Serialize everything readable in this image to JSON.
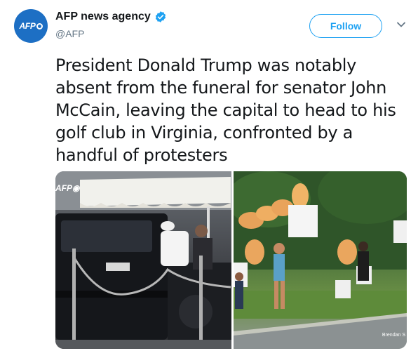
{
  "account": {
    "display_name": "AFP news agency",
    "handle": "@AFP",
    "avatar_text": "AFP",
    "verified": true
  },
  "follow_button": {
    "label": "Follow"
  },
  "menu": {
    "icon": "chevron-down-icon"
  },
  "tweet": {
    "text": "President Donald Trump was notably absent from the funeral for senator John McCain, leaving the capital to head to his golf club in Virginia, confronted by a handful of protesters"
  },
  "media": {
    "photo_left": {
      "watermark": "AFP"
    },
    "photo_right": {
      "credit": "Brendan S"
    }
  },
  "colors": {
    "brand_blue": "#1da1f2",
    "avatar_blue": "#1d6fc4",
    "text_primary": "#14171a",
    "text_secondary": "#657786"
  }
}
